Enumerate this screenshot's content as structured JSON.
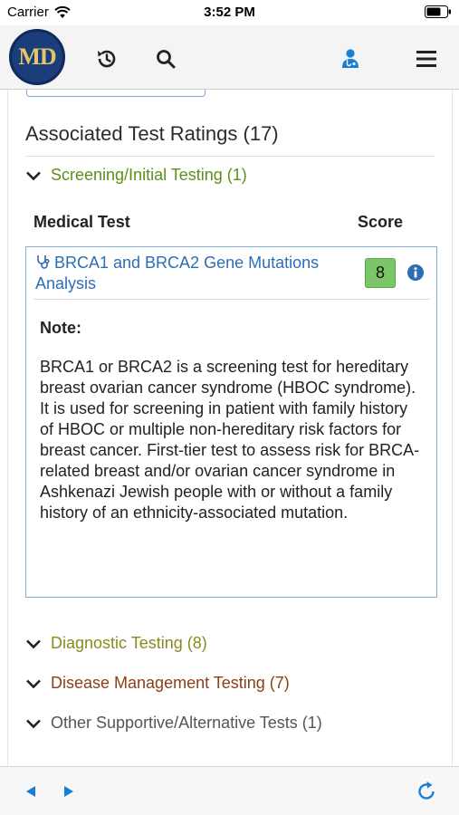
{
  "status_bar": {
    "carrier": "Carrier",
    "time": "3:52 PM"
  },
  "nav": {
    "logo_text": "MD",
    "icons": [
      "history-icon",
      "search-icon",
      "doctor-icon",
      "menu-icon"
    ]
  },
  "section": {
    "title": "Associated Test Ratings (17)"
  },
  "categories": {
    "screening": {
      "label": "Screening/Initial Testing (1)",
      "color": "#5e8e1a"
    },
    "diagnostic": {
      "label": "Diagnostic Testing (8)",
      "color": "#8a8a1c"
    },
    "management": {
      "label": "Disease Management Testing (7)",
      "color": "#8b3f13"
    },
    "other": {
      "label": "Other Supportive/Alternative Tests (1)",
      "color": "#555555"
    }
  },
  "table": {
    "col_test": "Medical Test",
    "col_score": "Score"
  },
  "test": {
    "name": "BRCA1 and BRCA2 Gene Mutations Analysis",
    "score": "8",
    "note_label": "Note:",
    "note_text": "BRCA1 or BRCA2 is a screening test for hereditary breast ovarian cancer syndrome (HBOC syndrome). It is used for screening in patient with family history of HBOC or multiple non-hereditary risk factors for breast cancer. First-tier test to assess risk for BRCA-related breast and/or ovarian cancer syndrome in Ashkenazi Jewish people with or without a family history of an ethnicity-associated mutation."
  },
  "colors": {
    "link": "#2d6db5",
    "accent": "#1a7fd4",
    "badge": "#7cc66a"
  }
}
